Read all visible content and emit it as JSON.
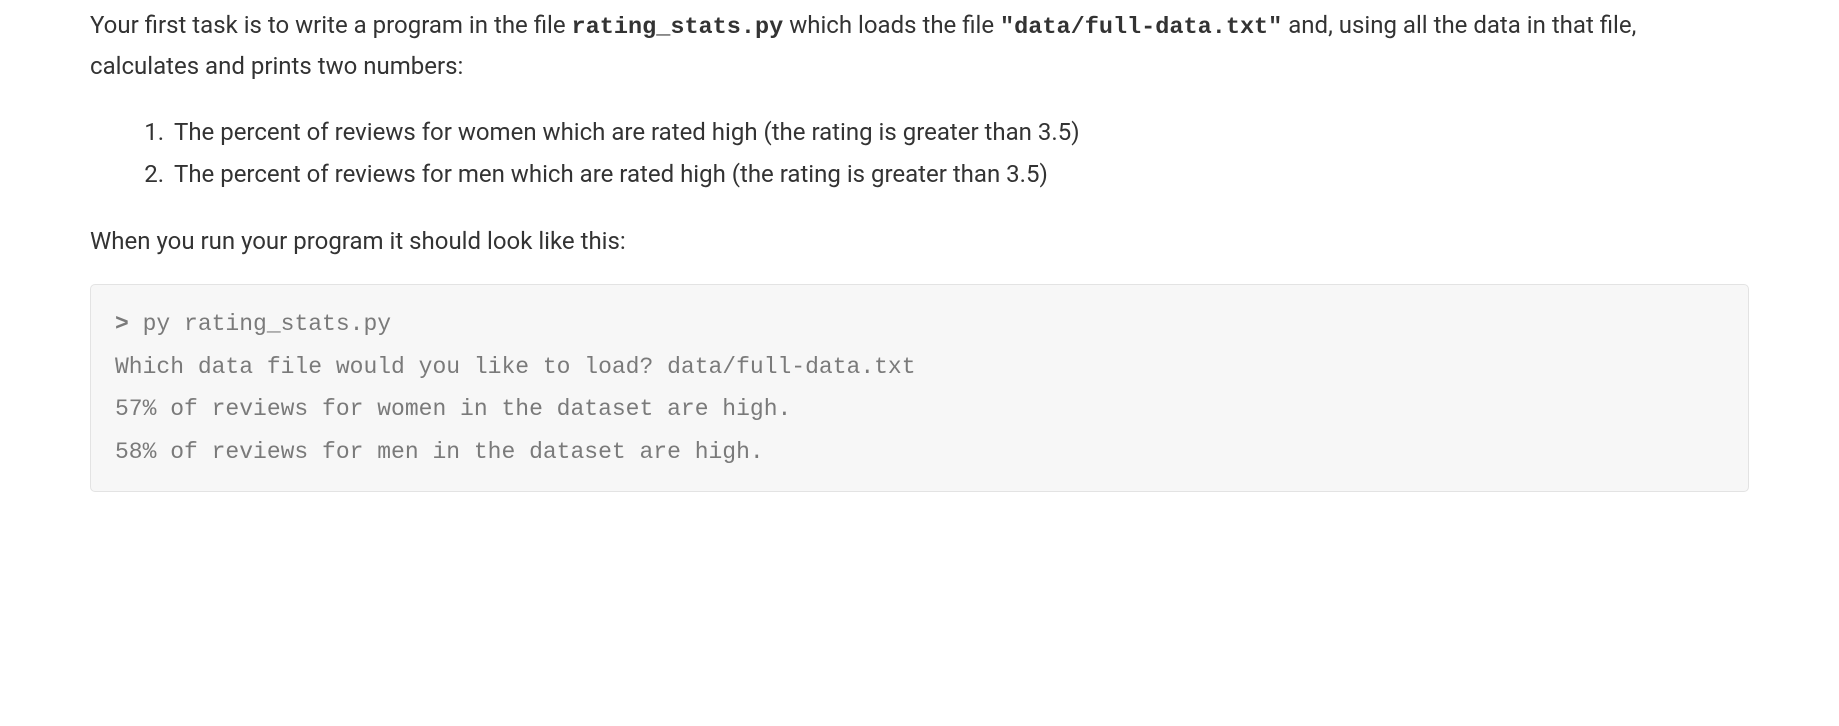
{
  "intro": {
    "part1": "Your first task is to write a program in the file ",
    "file1": "rating_stats.py",
    "part2": " which loads the file ",
    "quote_open": "\"",
    "file2": "data/full-data.txt",
    "quote_close": "\"",
    "part3": " and, using all the data in that file, calculates and prints two numbers:"
  },
  "list": {
    "items": [
      "The percent of reviews for women which are rated high (the rating is greater than 3.5)",
      "The percent of reviews for men which are rated high (the rating is greater than 3.5)"
    ]
  },
  "lead": "When you run your program it should look like this:",
  "code": {
    "prompt": ">",
    "cmd": " py rating_stats.py",
    "line2": "Which data file would you like to load? data/full-data.txt",
    "line3": "57% of reviews for women in the dataset are high.",
    "line4": "58% of reviews for men in the dataset are high."
  }
}
